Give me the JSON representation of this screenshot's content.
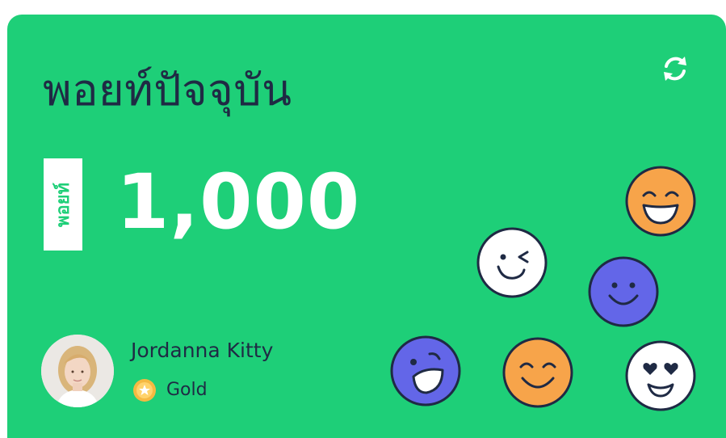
{
  "card": {
    "title": "พอยท์ปัจจุบัน",
    "points_unit": "พอยท์",
    "points_value": "1,000",
    "refresh_icon": "refresh-icon"
  },
  "user": {
    "name": "Jordanna Kitty",
    "tier": "Gold",
    "tier_icon": "star-badge-icon"
  },
  "colors": {
    "card_background": "#1ecf78",
    "text_dark": "#1f2a44",
    "smiley_orange": "#f7a44a",
    "smiley_purple": "#6366e8",
    "smiley_white": "#ffffff",
    "gold": "#f5b942"
  },
  "decorations": [
    "smiley-orange-grin-icon",
    "smiley-white-wink-icon",
    "smiley-purple-smile-icon",
    "smiley-purple-laugh-icon",
    "smiley-orange-happy-icon",
    "smiley-white-heart-eyes-icon"
  ]
}
